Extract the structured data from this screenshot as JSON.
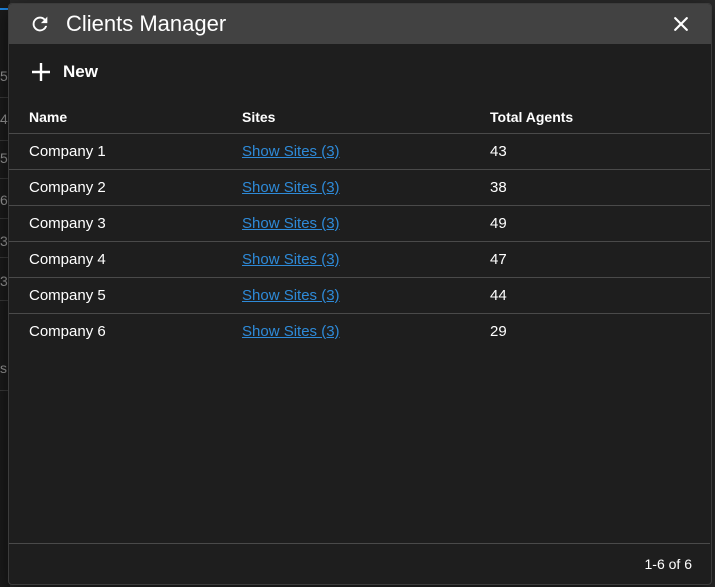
{
  "background": {
    "row_numbers": [
      "5",
      "4",
      "5",
      "6",
      "3",
      "3",
      "s"
    ]
  },
  "dialog": {
    "title": "Clients Manager",
    "refresh_icon": "refresh-icon",
    "close_icon": "close-icon"
  },
  "toolbar": {
    "new_label": "New",
    "new_icon": "plus-icon"
  },
  "table": {
    "headers": {
      "name": "Name",
      "sites": "Sites",
      "agents": "Total Agents"
    },
    "rows": [
      {
        "name": "Company 1",
        "sites": "Show Sites (3)",
        "agents": "43"
      },
      {
        "name": "Company 2",
        "sites": "Show Sites (3)",
        "agents": "38"
      },
      {
        "name": "Company 3",
        "sites": "Show Sites (3)",
        "agents": "49"
      },
      {
        "name": "Company 4",
        "sites": "Show Sites (3)",
        "agents": "47"
      },
      {
        "name": "Company 5",
        "sites": "Show Sites (3)",
        "agents": "44"
      },
      {
        "name": "Company 6",
        "sites": "Show Sites (3)",
        "agents": "29"
      }
    ]
  },
  "footer": {
    "pagination": "1-6 of 6"
  },
  "colors": {
    "link": "#2e8ad8",
    "titlebar": "#424242",
    "dialog_bg": "#1e1e1e"
  }
}
